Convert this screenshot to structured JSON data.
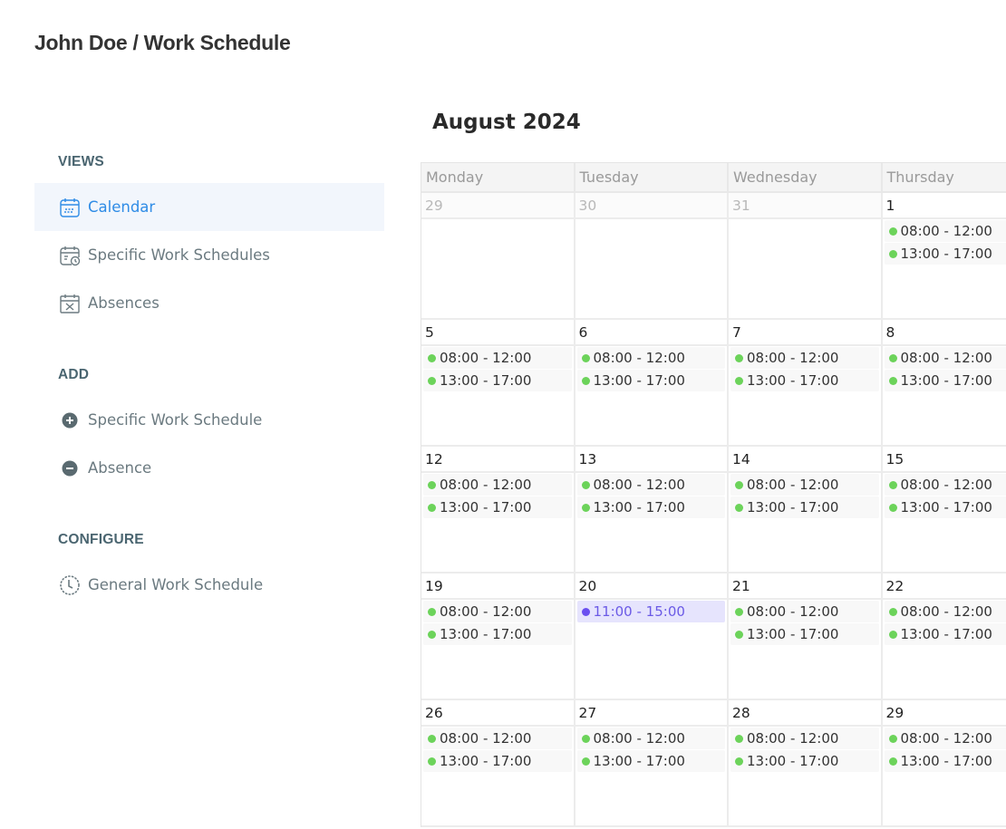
{
  "header": {
    "title": "John Doe / Work Schedule"
  },
  "sidebar": {
    "sections": [
      {
        "label": "VIEWS",
        "items": [
          {
            "label": "Calendar",
            "icon": "calendar-icon",
            "active": true
          },
          {
            "label": "Specific Work Schedules",
            "icon": "calendar-clock-icon",
            "active": false
          },
          {
            "label": "Absences",
            "icon": "calendar-x-icon",
            "active": false
          }
        ]
      },
      {
        "label": "ADD",
        "items": [
          {
            "label": "Specific Work Schedule",
            "icon": "plus-circle-icon"
          },
          {
            "label": "Absence",
            "icon": "minus-circle-icon"
          }
        ]
      },
      {
        "label": "CONFIGURE",
        "items": [
          {
            "label": "General Work Schedule",
            "icon": "dotted-clock-icon"
          }
        ]
      }
    ]
  },
  "calendar": {
    "month_title": "August 2024",
    "weekdays": [
      "Monday",
      "Tuesday",
      "Wednesday",
      "Thursday"
    ],
    "colors": {
      "regular_dot": "#6cd35a",
      "special_dot": "#6a4ff0",
      "special_bg": "#e6e4fd",
      "active": "#2f8ce6"
    },
    "weeks": [
      [
        {
          "day": "29",
          "other": true,
          "events": []
        },
        {
          "day": "30",
          "other": true,
          "events": []
        },
        {
          "day": "31",
          "other": true,
          "events": []
        },
        {
          "day": "1",
          "events": [
            {
              "time": "08:00 - 12:00"
            },
            {
              "time": "13:00 - 17:00"
            }
          ]
        }
      ],
      [
        {
          "day": "5",
          "events": [
            {
              "time": "08:00 - 12:00"
            },
            {
              "time": "13:00 - 17:00"
            }
          ]
        },
        {
          "day": "6",
          "events": [
            {
              "time": "08:00 - 12:00"
            },
            {
              "time": "13:00 - 17:00"
            }
          ]
        },
        {
          "day": "7",
          "events": [
            {
              "time": "08:00 - 12:00"
            },
            {
              "time": "13:00 - 17:00"
            }
          ]
        },
        {
          "day": "8",
          "events": [
            {
              "time": "08:00 - 12:00"
            },
            {
              "time": "13:00 - 17:00"
            }
          ]
        }
      ],
      [
        {
          "day": "12",
          "events": [
            {
              "time": "08:00 - 12:00"
            },
            {
              "time": "13:00 - 17:00"
            }
          ]
        },
        {
          "day": "13",
          "events": [
            {
              "time": "08:00 - 12:00"
            },
            {
              "time": "13:00 - 17:00"
            }
          ]
        },
        {
          "day": "14",
          "events": [
            {
              "time": "08:00 - 12:00"
            },
            {
              "time": "13:00 - 17:00"
            }
          ]
        },
        {
          "day": "15",
          "events": [
            {
              "time": "08:00 - 12:00"
            },
            {
              "time": "13:00 - 17:00"
            }
          ]
        }
      ],
      [
        {
          "day": "19",
          "events": [
            {
              "time": "08:00 - 12:00"
            },
            {
              "time": "13:00 - 17:00"
            }
          ]
        },
        {
          "day": "20",
          "events": [
            {
              "time": "11:00 - 15:00",
              "special": true
            }
          ]
        },
        {
          "day": "21",
          "events": [
            {
              "time": "08:00 - 12:00"
            },
            {
              "time": "13:00 - 17:00"
            }
          ]
        },
        {
          "day": "22",
          "events": [
            {
              "time": "08:00 - 12:00"
            },
            {
              "time": "13:00 - 17:00"
            }
          ]
        }
      ],
      [
        {
          "day": "26",
          "events": [
            {
              "time": "08:00 - 12:00"
            },
            {
              "time": "13:00 - 17:00"
            }
          ]
        },
        {
          "day": "27",
          "events": [
            {
              "time": "08:00 - 12:00"
            },
            {
              "time": "13:00 - 17:00"
            }
          ]
        },
        {
          "day": "28",
          "events": [
            {
              "time": "08:00 - 12:00"
            },
            {
              "time": "13:00 - 17:00"
            }
          ]
        },
        {
          "day": "29",
          "events": [
            {
              "time": "08:00 - 12:00"
            },
            {
              "time": "13:00 - 17:00"
            }
          ]
        }
      ]
    ]
  }
}
